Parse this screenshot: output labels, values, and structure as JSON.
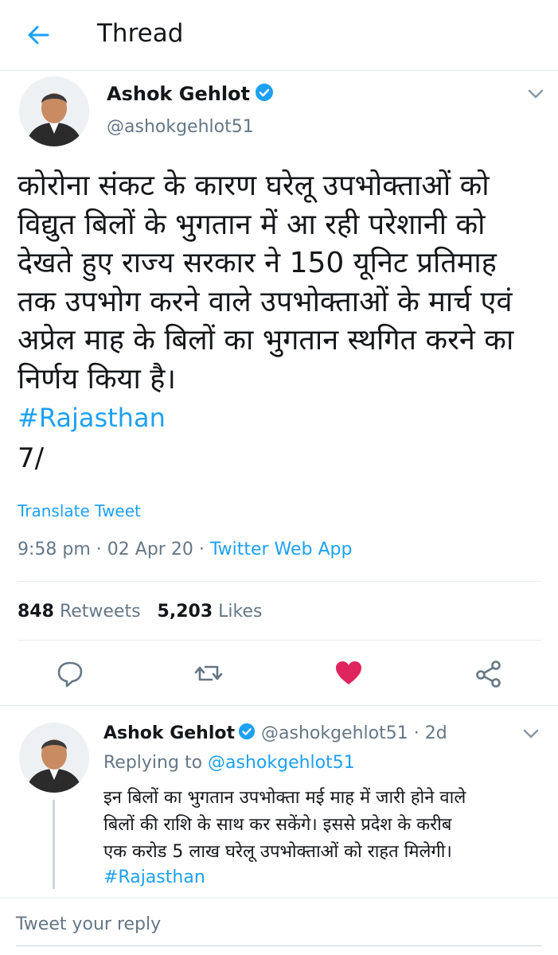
{
  "header": {
    "title": "Thread",
    "back_icon": "arrow-left-icon"
  },
  "colors": {
    "accent": "#1da1f2",
    "like": "#e0245e",
    "secondary_text": "#657786",
    "divider": "#e6ecf0"
  },
  "tweet": {
    "author_name": "Ashok Gehlot",
    "handle": "@ashokgehlot51",
    "text": "कोरोना संकट के कारण घरेलू उपभोक्ताओं को\nविद्युत बिलों के भुगतान में आ रही परेशानी को\nदेखते हुए राज्य सरकार ने 150 यूनिट प्रतिमाह\nतक उपभोग करने वाले उपभोक्ताओं के मार्च एवं\nअप्रेल माह के बिलों का भुगतान स्थगित करने का\nनिर्णय किया है।",
    "hashtag": "#Rajasthan",
    "thread_counter": "7/",
    "translate_label": "Translate Tweet",
    "time": "9:58 pm",
    "date": "02 Apr 20",
    "source": "Twitter Web App",
    "retweets_count": "848",
    "retweets_label": "Retweets",
    "likes_count": "5,203",
    "likes_label": "Likes",
    "actions": [
      "reply-icon",
      "retweet-icon",
      "like-icon",
      "share-icon"
    ]
  },
  "reply": {
    "author_name": "Ashok Gehlot",
    "handle": "@ashokgehlot51",
    "age": "2d",
    "replying_label": "Replying to",
    "replying_handle": "@ashokgehlot51",
    "text": "इन बिलों का भुगतान उपभोक्ता मई माह में जारी होने वाले\nबिलों की राशि के साथ कर सकेंगे। इससे प्रदेश के करीब\nएक करोड 5 लाख घरेलू उपभोक्ताओं को राहत मिलेगी।",
    "hashtag": "#Rajasthan"
  },
  "composer": {
    "placeholder": "Tweet your reply"
  }
}
